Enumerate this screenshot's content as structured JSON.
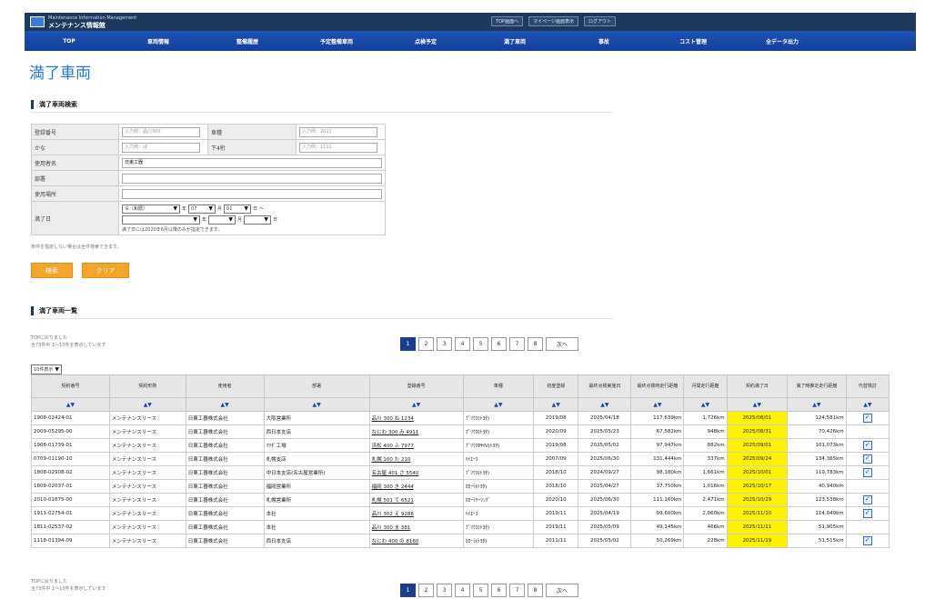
{
  "header": {
    "logo_en": "Maintenance Information Management",
    "logo_jp": "メンテナンス情報館",
    "top_links": [
      "TOP画面へ",
      "マイページ画面表示",
      "ログアウト"
    ]
  },
  "nav": [
    "TOP",
    "車両情報",
    "整備履歴",
    "予定整備車両",
    "点検予定",
    "満了車両",
    "事故",
    "コスト管理",
    "全データ出力"
  ],
  "page_title": "満了車両",
  "search": {
    "section_title": "満了車両検索",
    "rows": [
      {
        "label": "登録番号",
        "value": "入力例：品川300",
        "label2": "車種",
        "value2": "入力例：2011"
      },
      {
        "label": "かな",
        "value": "入力例：ぱ",
        "label2": "下4桁",
        "value2": "入力例：1111"
      }
    ],
    "company_label": "使用者名",
    "company_value": "日東工器",
    "dept_label": "部署",
    "place_label": "使用場所",
    "end_label": "満了日",
    "end_era": "令（和暦）",
    "end_year_unit": "年",
    "end_month": "07",
    "end_month_unit": "月",
    "end_day": "01",
    "end_day_unit": "日",
    "range_sep": "〜",
    "end_note": "満了日には2020年6月以降のみが指定できます。",
    "form_note": "条件を指定しない場合は全件検索できます。",
    "search_btn": "検索",
    "clear_btn": "クリア"
  },
  "results": {
    "section_title": "満了車両一覧",
    "msg_line1": "TOPに戻りました",
    "msg_line2": "全73件中 1～10件を表示しています",
    "per_page": "10件表示",
    "pages": [
      "1",
      "2",
      "3",
      "4",
      "5",
      "6",
      "7",
      "8"
    ],
    "next_label": "次へ",
    "sort_label": "▲▼",
    "columns": [
      "契約番号",
      "契約形態",
      "使用者",
      "部署",
      "登録番号",
      "車種",
      "初度登録",
      "最終点検実施日",
      "最終点検時走行距離",
      "月間走行距離",
      "契約満了日",
      "満了時推定走行距離",
      "代替検討"
    ],
    "rows": [
      [
        "1908-02424-01",
        "メンテナンスリース",
        "日東工器株式会社",
        "大阪営業所",
        "品川 300 ね 1234",
        "ﾌﾟﾘｳｽ(ﾄﾖﾀ)",
        "2019/08",
        "2025/04/18",
        "117,639km",
        "1,726km",
        "2025/08/01",
        "124,581km",
        true
      ],
      [
        "2009-05295-00",
        "メンテナンスリース",
        "日東工器株式会社",
        "西日本支店",
        "なにわ 300 み 4911",
        "ﾌﾟﾘｳｽ(ﾄﾖﾀ)",
        "2020/09",
        "2025/05/23",
        "67,582km",
        "948km",
        "2025/08/31",
        "70,426km",
        false
      ],
      [
        "1908-01739-01",
        "メンテナンスリース",
        "日東工器株式会社",
        "ﾏﾂﾀﾞ工場",
        "浜松 400 ふ 7977",
        "ﾌﾟﾘｳｽPHV(ﾄﾖﾀ)",
        "2019/08",
        "2025/05/02",
        "97,947km",
        "882km",
        "2025/09/01",
        "101,073km",
        true
      ],
      [
        "0709-01190-10",
        "メンテナンスリース",
        "日東工器株式会社",
        "札幌支店",
        "札幌 100 た 210",
        "ﾊｲｴｰｽ",
        "2007/09",
        "2025/06/30",
        "131,444km",
        "337km",
        "2025/09/24",
        "134,365km",
        true
      ],
      [
        "1808-02908-02",
        "メンテナンスリース",
        "日東工器株式会社",
        "中日本支店(名古屋営業所)",
        "名古屋 401 さ 5540",
        "ﾌﾟﾘｳｽ(ﾄﾖﾀ)",
        "2018/10",
        "2024/09/27",
        "98,180km",
        "1,661km",
        "2025/10/01",
        "119,783km",
        true
      ],
      [
        "1808-02037-01",
        "メンテナンスリース",
        "日東工器株式会社",
        "福岡営業所",
        "福岡 300 き 2444",
        "ｶﾛｰﾗ(ﾄﾖﾀ)",
        "2018/10",
        "2025/04/27",
        "37,750km",
        "1,016km",
        "2025/10/17",
        "40,940km",
        false
      ],
      [
        "2010-01875-00",
        "メンテナンスリース",
        "日東工器株式会社",
        "札幌営業所",
        "札幌 501 て 6521",
        "ｶﾛｰﾗﾂｰﾘﾝｸﾞ",
        "2020/10",
        "2025/06/30",
        "111,160km",
        "2,471km",
        "2025/10/29",
        "123,538km",
        true
      ],
      [
        "1911-02754-01",
        "メンテナンスリース",
        "日東工器株式会社",
        "本社",
        "品川 302 え 9288",
        "ﾊｲｴｰｽ",
        "2019/11",
        "2025/04/19",
        "99,600km",
        "2,060km",
        "2025/11/10",
        "114,049km",
        true
      ],
      [
        "1811-02537-02",
        "メンテナンスリース",
        "日東工器株式会社",
        "本社",
        "品川 300 ま 381",
        "ﾌﾟﾘｳｽ(ﾄﾖﾀ)",
        "2019/11",
        "2025/05/09",
        "49,145km",
        "466km",
        "2025/11/11",
        "51,905km",
        false
      ],
      [
        "1118-01394-09",
        "メンテナンスリース",
        "日東工器株式会社",
        "西日本支店",
        "なにわ 400 の 8160",
        "ｶﾛｰﾗ(ﾄﾖﾀ)",
        "2011/11",
        "2025/05/02",
        "50,269km",
        "228km",
        "2025/11/19",
        "51,515km",
        true
      ]
    ],
    "bottom_msg_line1": "TOPに戻りました",
    "bottom_msg_line2": "全73件中 1～10件を表示しています"
  }
}
